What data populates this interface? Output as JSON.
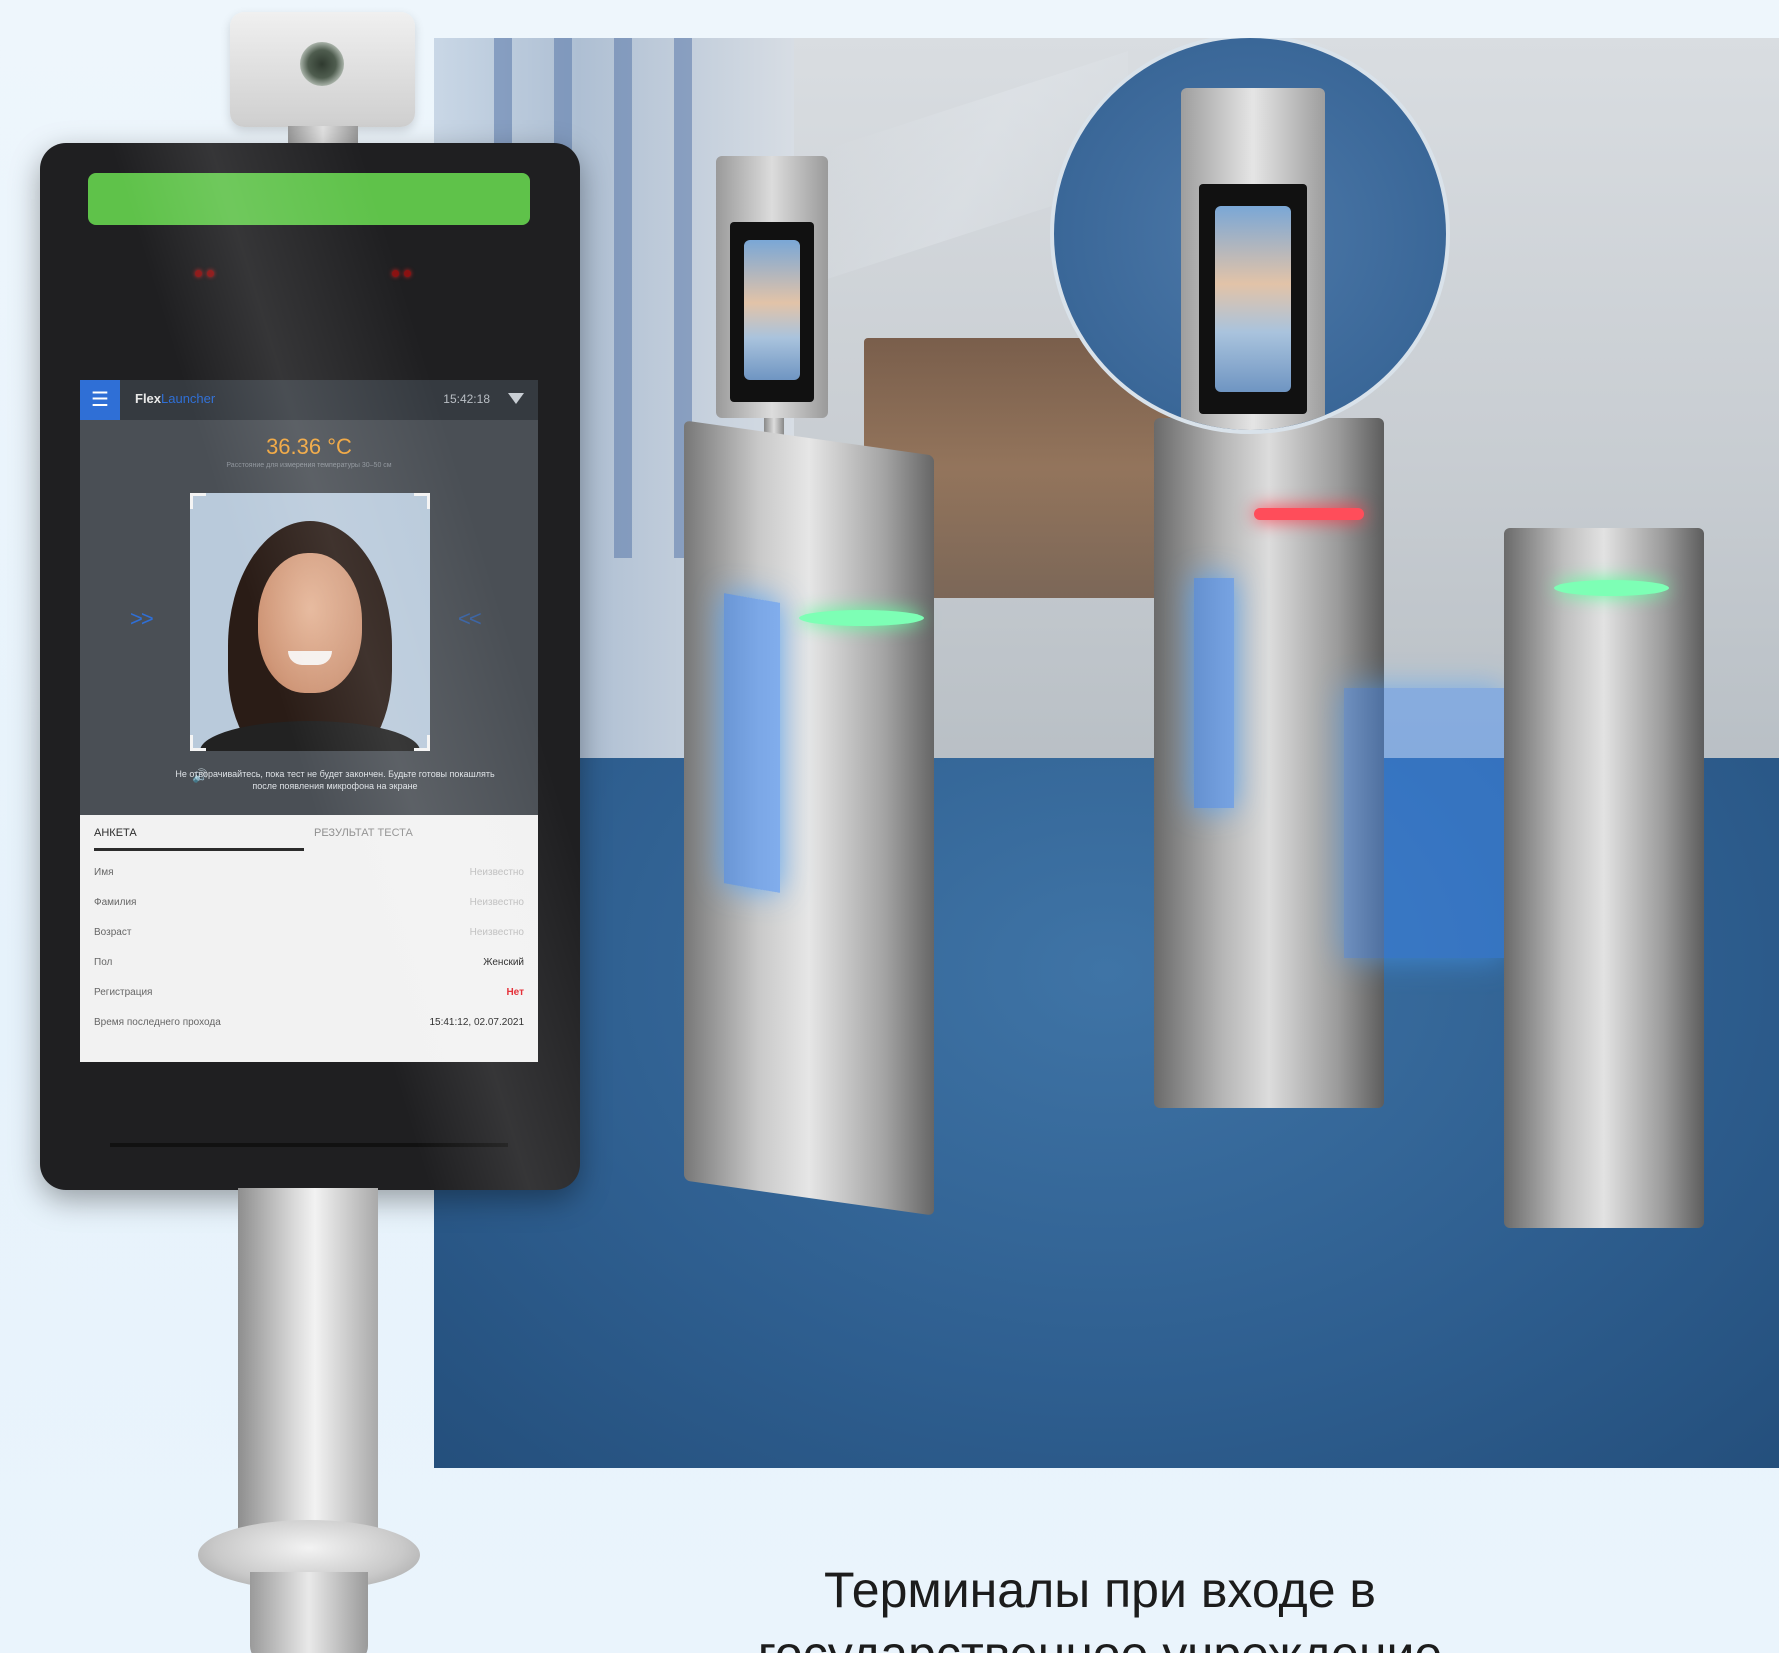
{
  "terminal": {
    "app_name_primary": "Flex",
    "app_name_accent": "Launcher",
    "clock": "15:42:18",
    "menu_icon": "hamburger-icon",
    "wifi_icon": "wifi-icon",
    "temperature": "36.36 °C",
    "temperature_hint": "Расстояние для измерения температуры 30–50 см",
    "voice_hint": "Не отворачивайтесь, пока тест не будет закончен. Будьте готовы покашлять после появления микрофона на экране",
    "speaker_icon": "speaker-icon",
    "tabs": [
      {
        "label": "АНКЕТА"
      },
      {
        "label": "РЕЗУЛЬТАТ ТЕСТА"
      }
    ],
    "fields": [
      {
        "label": "Имя",
        "value": "Неизвестно"
      },
      {
        "label": "Фамилия",
        "value": "Неизвестно"
      },
      {
        "label": "Возраст",
        "value": "Неизвестно"
      },
      {
        "label": "Пол",
        "value": "Женский"
      },
      {
        "label": "Регистрация",
        "value": "Нет"
      },
      {
        "label": "Время последнего прохода",
        "value": "15:41:12, 02.07.2021"
      }
    ]
  },
  "caption": {
    "line1": "Терминалы при входе в",
    "line2": "государственное учреждение"
  },
  "colors": {
    "status_ok": "#5fc24a",
    "accent_blue": "#2f6fd6",
    "temperature": "#f0a43a",
    "alert_red": "#e3222b"
  }
}
